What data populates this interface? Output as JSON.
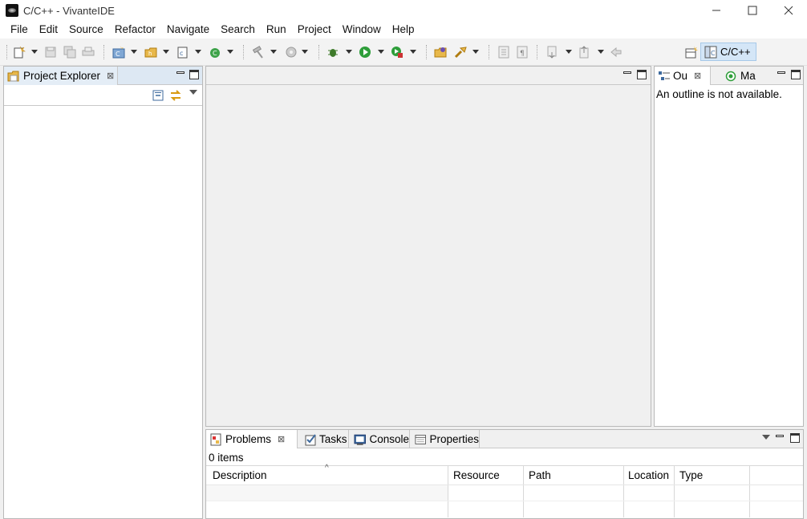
{
  "window": {
    "title": "C/C++ - VivanteIDE",
    "controls": {
      "minimize": "—",
      "maximize": "☐",
      "close": "✕"
    }
  },
  "menu": [
    "File",
    "Edit",
    "Source",
    "Refactor",
    "Navigate",
    "Search",
    "Run",
    "Project",
    "Window",
    "Help"
  ],
  "perspective": {
    "label": "C/C++"
  },
  "project_explorer": {
    "tab_label": "Project Explorer",
    "close": "⊠"
  },
  "outline": {
    "tab_label": "Ou",
    "close": "⊠",
    "message": "An outline is not available."
  },
  "make_tab": {
    "label": "Ma"
  },
  "bottom_tabs": {
    "problems": "Problems",
    "tasks": "Tasks",
    "console": "Console",
    "properties": "Properties",
    "close": "⊠"
  },
  "problems": {
    "count": "0 items",
    "columns": [
      "Description",
      "Resource",
      "Path",
      "Location",
      "Type"
    ]
  },
  "icons": {
    "colors": {
      "accent": "#d4e6f7",
      "accent_border": "#a6c8e8",
      "folder": "#e8b84a",
      "run_green": "#2e9e3a",
      "debug_green": "#3e7a2a",
      "tab_active_bg": "#ffffff",
      "header_bg": "#f0f0f0"
    }
  }
}
